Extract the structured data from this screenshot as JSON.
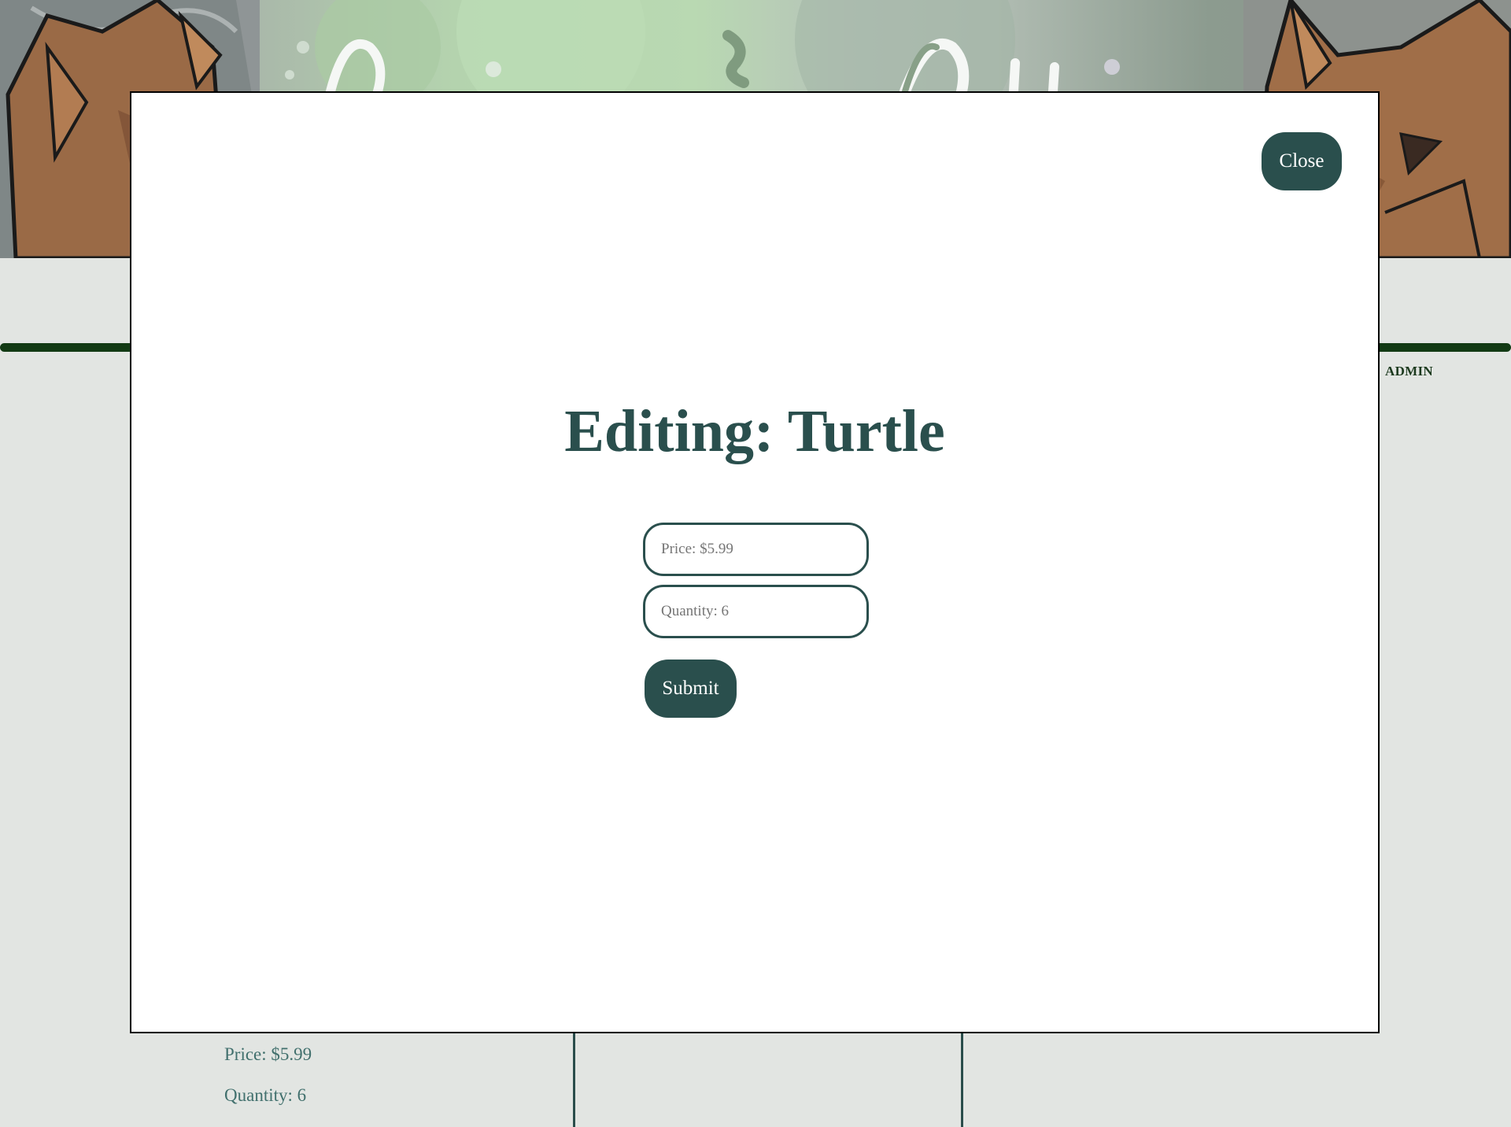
{
  "modal": {
    "close_label": "Close",
    "title": "Editing: Turtle",
    "price_placeholder": "Price: $5.99",
    "quantity_placeholder": "Quantity: 6",
    "submit_label": "Submit"
  },
  "nav": {
    "admin_label": "ADMIN"
  },
  "product_card": {
    "price_text": "Price: $5.99",
    "quantity_text": "Quantity: 6"
  },
  "colors": {
    "accent": "#2a4f4d",
    "navbar": "#123a14",
    "background": "#e2e5e2"
  }
}
